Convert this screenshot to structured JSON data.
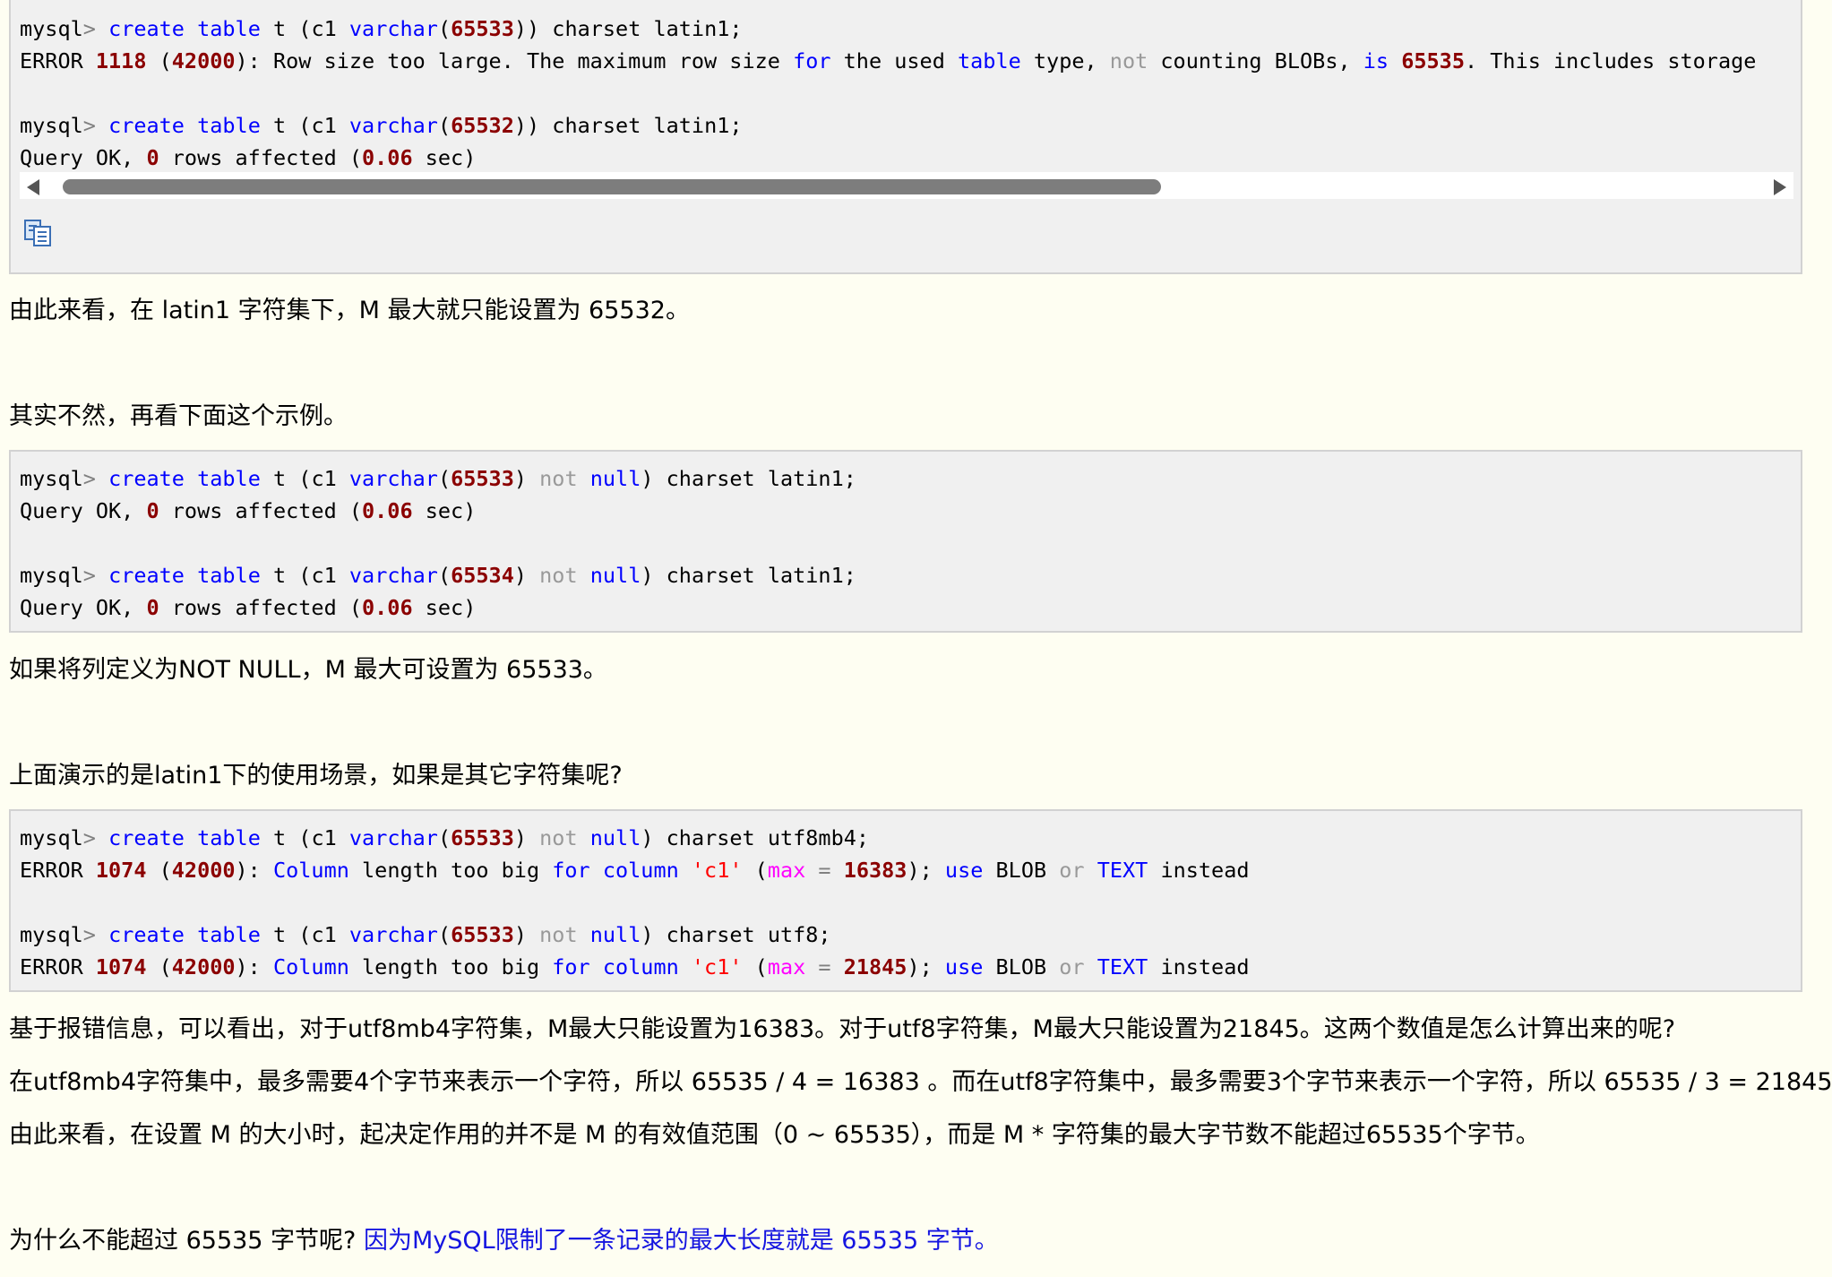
{
  "code_block_1": {
    "line1": {
      "prompt": "mysql",
      "op": ">",
      "kw1": "create",
      "kw2": "table",
      "t1": " t (c1 ",
      "fn": "varchar",
      "p1": "(",
      "num": "65533",
      "rest": ")) charset latin1;"
    },
    "line2": {
      "err": "ERROR ",
      "code": "1118",
      "p1": " (",
      "state": "42000",
      "t1": "): Row size too large. The maximum row size ",
      "kw_for": "for",
      "t2": " the used ",
      "kw_table": "table",
      "t3": " type, ",
      "kw_not": "not",
      "t4": " counting BLOBs, ",
      "kw_is": "is",
      "t5": " ",
      "num": "65535",
      "t6": ". This includes storage"
    },
    "line3": {
      "prompt": "mysql",
      "op": ">",
      "kw1": "create",
      "kw2": "table",
      "t1": " t (c1 ",
      "fn": "varchar",
      "p1": "(",
      "num": "65532",
      "rest": ")) charset latin1;"
    },
    "line4": {
      "t1": "Query OK, ",
      "n1": "0",
      "t2": " rows affected (",
      "n2": "0.06",
      "t3": " sec)"
    }
  },
  "para1": "由此来看，在 latin1 字符集下，M 最大就只能设置为 65532。",
  "para2": "其实不然，再看下面这个示例。",
  "code_block_2": {
    "line1": {
      "prompt": "mysql",
      "op": ">",
      "kw1": "create",
      "kw2": "table",
      "t1": " t (c1 ",
      "fn": "varchar",
      "p1": "(",
      "num": "65533",
      "p2": ") ",
      "not": "not",
      "null": "null",
      "rest": ") charset latin1;"
    },
    "line2": {
      "t1": "Query OK, ",
      "n1": "0",
      "t2": " rows affected (",
      "n2": "0.06",
      "t3": " sec)"
    },
    "line3": {
      "prompt": "mysql",
      "op": ">",
      "kw1": "create",
      "kw2": "table",
      "t1": " t (c1 ",
      "fn": "varchar",
      "p1": "(",
      "num": "65534",
      "p2": ") ",
      "not": "not",
      "null": "null",
      "rest": ") charset latin1;"
    },
    "line4": {
      "t1": "Query OK, ",
      "n1": "0",
      "t2": " rows affected (",
      "n2": "0.06",
      "t3": " sec)"
    }
  },
  "para3": "如果将列定义为NOT NULL，M 最大可设置为 65533。",
  "para4": "上面演示的是latin1下的使用场景，如果是其它字符集呢?",
  "code_block_3": {
    "line1": {
      "prompt": "mysql",
      "op": ">",
      "kw1": "create",
      "kw2": "table",
      "t1": " t (c1 ",
      "fn": "varchar",
      "p1": "(",
      "num": "65533",
      "p2": ") ",
      "not": "not",
      "null": "null",
      "rest": ") charset utf8mb4;"
    },
    "line2": {
      "err": "ERROR ",
      "code": "1074",
      "p1": " (",
      "state": "42000",
      "p2": "): ",
      "kw_column": "Column",
      "t1": " length too big ",
      "kw_for": "for",
      "t2": " ",
      "kw_column2": "column",
      "t3": " ",
      "str": "'c1'",
      "t4": " (",
      "max": "max",
      "t5": " ",
      "eq": "=",
      "t6": " ",
      "num": "16383",
      "t7": "); ",
      "kw_use": "use",
      "t8": " BLOB ",
      "kw_or": "or",
      "t9": " ",
      "kw_text": "TEXT",
      "t10": " instead"
    },
    "line3": {
      "prompt": "mysql",
      "op": ">",
      "kw1": "create",
      "kw2": "table",
      "t1": " t (c1 ",
      "fn": "varchar",
      "p1": "(",
      "num": "65533",
      "p2": ") ",
      "not": "not",
      "null": "null",
      "rest": ") charset utf8;"
    },
    "line4": {
      "err": "ERROR ",
      "code": "1074",
      "p1": " (",
      "state": "42000",
      "p2": "): ",
      "kw_column": "Column",
      "t1": " length too big ",
      "kw_for": "for",
      "t2": " ",
      "kw_column2": "column",
      "t3": " ",
      "str": "'c1'",
      "t4": " (",
      "max": "max",
      "t5": " ",
      "eq": "=",
      "t6": " ",
      "num": "21845",
      "t7": "); ",
      "kw_use": "use",
      "t8": " BLOB ",
      "kw_or": "or",
      "t9": " ",
      "kw_text": "TEXT",
      "t10": " instead"
    }
  },
  "para5": "基于报错信息，可以看出，对于utf8mb4字符集，M最大只能设置为16383。对于utf8字符集，M最大只能设置为21845。这两个数值是怎么计算出来的呢?",
  "para6": "在utf8mb4字符集中，最多需要4个字节来表示一个字符，所以 65535 / 4 = 16383 。而在utf8字符集中，最多需要3个字节来表示一个字符，所以 65535 / 3 = 21845。",
  "para7": "由此来看，在设置 M 的大小时，起决定作用的并不是 M 的有效值范围（0 ~ 65535），而是 M * 字符集的最大字节数不能超过65535个字节。",
  "para8": {
    "text": "为什么不能超过 65535 字节呢? ",
    "link": "因为MySQL限制了一条记录的最大长度就是 65535 字节。"
  },
  "icons": {
    "copy": "copy-icon",
    "scroll_left": "arrow-left-icon",
    "scroll_right": "arrow-right-icon"
  },
  "colors": {
    "page_background": "#fefef2",
    "code_background": "#f0f0f0",
    "keyword": "#0000ff",
    "number": "#8b0000",
    "string": "#ff0000",
    "builtin": "#ff00ff",
    "muted": "#999999",
    "link": "#1515e0"
  }
}
